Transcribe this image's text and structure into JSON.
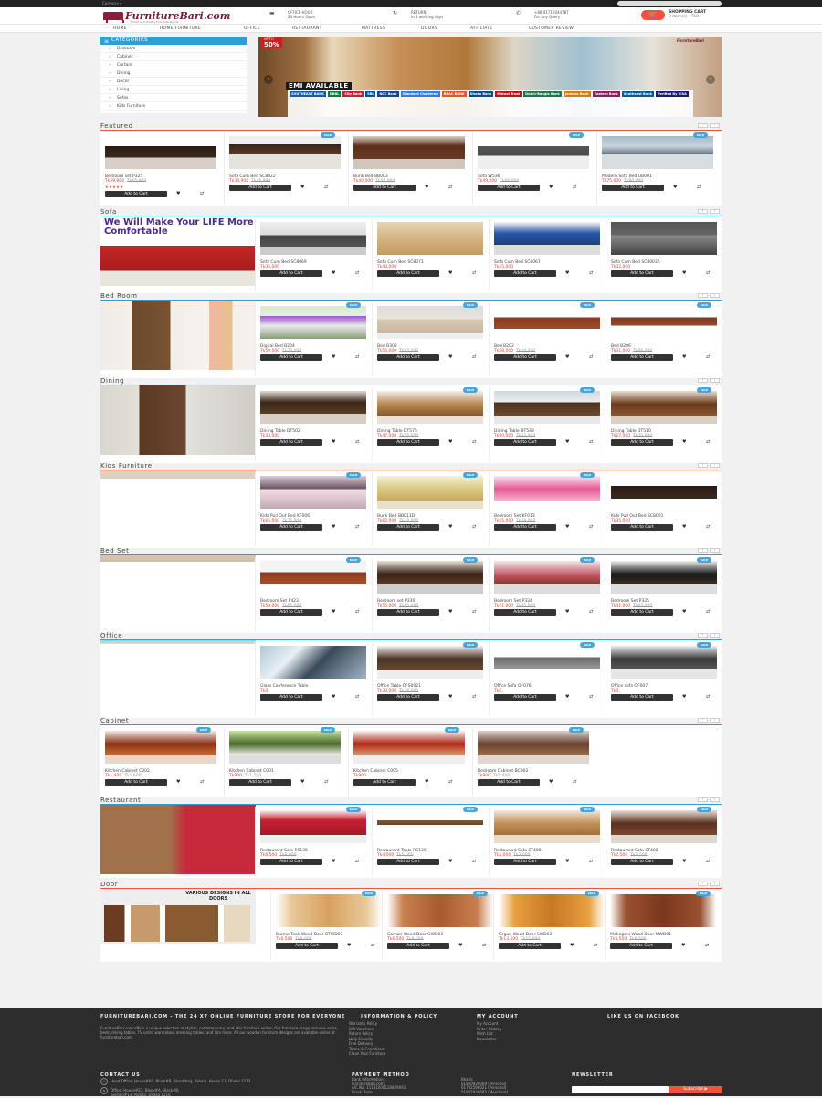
{
  "topbar": {
    "currency": "Currency ▾",
    "search_placeholder": "Search"
  },
  "header": {
    "logo": "FurnitureBari.com",
    "logo_sub": "Smart and Quality Furniture Online",
    "office_hour_title": "OFFICE HOUR",
    "office_hour_text": "24 Hours Open",
    "return_title": "RETURN",
    "return_text": "In 3 working days",
    "phone": "+88 01716044787",
    "phone_text": "For any Query",
    "cart_title": "SHOPPING CART",
    "cart_count": "0 item(s) - Tk0"
  },
  "nav": [
    "HOME",
    "HOME FURNITURE",
    "OFFICE",
    "RESTAURANT",
    "MATTRESS",
    "DOORS",
    "AFFILIATE",
    "CUSTOMER REVIEW"
  ],
  "categories": {
    "title": "CATEGORIES",
    "items": [
      "Bedroom",
      "Cabinet",
      "Curtain",
      "Dining",
      "Decor",
      "Living",
      "Sofas",
      "Kids Furniture"
    ]
  },
  "banner": {
    "sale_title": "UP TO",
    "sale_value": "50%",
    "emi": "EMI AVAILABLE",
    "banks": [
      "SOUTHEAST BANK",
      "DBBL",
      "City Bank",
      "EBL",
      "NCC Bank",
      "Standard Chartered",
      "BRAC BANK",
      "Dhaka Bank",
      "Mutual Trust",
      "Dutch-Bangla Bank",
      "Jamuna Bank",
      "Eastern Bank",
      "Southeast Bank",
      "Verified By VISA"
    ],
    "brand": "FurnitureBari"
  },
  "colors": {
    "accent": "#2c9fd4",
    "price": "#e4422d",
    "cart": "#f0523d",
    "footer": "#2d2d2d"
  },
  "sections": [
    {
      "title": "Featured",
      "products": [
        {
          "name": "Bedroom set P325",
          "price": "Tk59,900",
          "old": "Tk65,900",
          "sale": false,
          "stars": "★★★★★"
        },
        {
          "name": "Sofa Cum Bed SC8022",
          "price": "Tk39,900",
          "old": "Tk46,999",
          "sale": true
        },
        {
          "name": "Bunk Bed BB003",
          "price": "Tk40,000",
          "old": "Tk56,000",
          "sale": false
        },
        {
          "name": "Sofa W536",
          "price": "Tk49,000",
          "old": "Tk66,000",
          "sale": true
        },
        {
          "name": "Modern Sofa Bed UB001",
          "price": "Tk75,000",
          "old": "Tk90,000",
          "sale": true
        }
      ]
    },
    {
      "title": "Sofa",
      "promo": "We Will Make Your LIFE More Comfortable",
      "products": [
        {
          "name": "Sofa Cum Bed SC8069",
          "price": "Tk35,000",
          "old": "",
          "sale": false
        },
        {
          "name": "Sofa Cum Bed SC8071",
          "price": "Tk43,000",
          "old": "",
          "sale": false
        },
        {
          "name": "Sofa Cum Bed SC8067",
          "price": "Tk45,000",
          "old": "",
          "sale": false
        },
        {
          "name": "Sofa Cum Bed SC80035",
          "price": "Tk32,000",
          "old": "",
          "sale": false
        }
      ]
    },
    {
      "title": "Bed Room",
      "products": [
        {
          "name": "Digital Bed B204",
          "price": "Tk59,000",
          "old": "Tk70,000",
          "sale": true
        },
        {
          "name": "Bed B302",
          "price": "Tk55,000",
          "old": "Tk65,000",
          "sale": true
        },
        {
          "name": "Bed B202",
          "price": "Tk18,000",
          "old": "Tk24,000",
          "sale": true
        },
        {
          "name": "Bed B206",
          "price": "Tk31,000",
          "old": "Tk36,000",
          "sale": true
        }
      ]
    },
    {
      "title": "Dining",
      "products": [
        {
          "name": "Dining Table DT502",
          "price": "Tk33,000",
          "old": "",
          "sale": false
        },
        {
          "name": "Dining Table DT575",
          "price": "Tk47,000",
          "old": "Tk50,000",
          "sale": true
        },
        {
          "name": "Dining Table DT548",
          "price": "Tk60,000",
          "old": "Tk62,000",
          "sale": true
        },
        {
          "name": "Dining Table DT510",
          "price": "Tk27,000",
          "old": "Tk30,000",
          "sale": true
        }
      ]
    },
    {
      "title": "Kids Furniture",
      "products": [
        {
          "name": "Kids Pull Out Bed KF006",
          "price": "Tk65,000",
          "old": "Tk75,000",
          "sale": true
        },
        {
          "name": "Bunk Bed BB011D",
          "price": "Tk60,000",
          "old": "Tk70,000",
          "sale": true
        },
        {
          "name": "Bedroom Set KF013",
          "price": "Tk45,000",
          "old": "Tk49,000",
          "sale": true
        },
        {
          "name": "Kids Pull Out Bed SC8001",
          "price": "Tk35,000",
          "old": "",
          "sale": false
        }
      ]
    },
    {
      "title": "Bed Set",
      "products": [
        {
          "name": "Bedroom Set P423",
          "price": "Tk58,000",
          "old": "Tk65,000",
          "sale": true
        },
        {
          "name": "Bedroom set P330",
          "price": "Tk55,000",
          "old": "Tk60,000",
          "sale": true
        },
        {
          "name": "Bedroom Set P334",
          "price": "Tk41,000",
          "old": "Tk45,000",
          "sale": true
        },
        {
          "name": "Bedroom Set P335",
          "price": "Tk41,000",
          "old": "Tk45,000",
          "sale": true
        }
      ]
    },
    {
      "title": "Office",
      "products": [
        {
          "name": "Glass Conference Table",
          "price": "Tk0",
          "old": "",
          "sale": false
        },
        {
          "name": "Office Table OFS0021",
          "price": "Tk30,000",
          "old": "Tk36,000",
          "sale": true
        },
        {
          "name": "Office Sofa OF076",
          "price": "Tk0",
          "old": "",
          "sale": true
        },
        {
          "name": "Office sofa OF007",
          "price": "Tk0",
          "old": "",
          "sale": true
        }
      ]
    },
    {
      "title": "Cabinet",
      "products": [
        {
          "name": "Kitchen Cabinet C002",
          "price": "Tk1,400",
          "old": "Tk1,600",
          "sale": true
        },
        {
          "name": "Kitchen Cabinet C001",
          "price": "Tk900",
          "old": "Tk1,100",
          "sale": true
        },
        {
          "name": "Kitchen Cabinet C005",
          "price": "Tk900",
          "old": "",
          "sale": true
        },
        {
          "name": "Bedroom Cabinet BC002",
          "price": "Tk900",
          "old": "Tk1,400",
          "sale": true
        }
      ]
    },
    {
      "title": "Restaurant",
      "products": [
        {
          "name": "Restaurant Sofa RS135",
          "price": "Tk6,500",
          "old": "Tk8,000",
          "sale": true
        },
        {
          "name": "Restaurant Table RS136",
          "price": "Tk4,000",
          "old": "Tk5,000",
          "sale": true
        },
        {
          "name": "Restaurant Sofa ST406",
          "price": "Tk2,000",
          "old": "Tk3,000",
          "sale": true
        },
        {
          "name": "Restaurant Sofa ST402",
          "price": "Tk2,500",
          "old": "Tk3,500",
          "sale": true
        }
      ]
    },
    {
      "title": "Door",
      "promo": "VARIOUS DESIGNS IN ALL DOORS",
      "products": [
        {
          "name": "Burma Teak Wood Door BTWD03",
          "price": "Tk6,500",
          "old": "Tk8,000",
          "sale": true
        },
        {
          "name": "Gamari Wood Door GWD03",
          "price": "Tk6,500",
          "old": "Tk8,000",
          "sale": true
        },
        {
          "name": "Segun Wood Door SWD03",
          "price": "Tk13,500",
          "old": "Tk15,000",
          "sale": true
        },
        {
          "name": "Mehogoni Wood Door MWD01",
          "price": "Tk5,500",
          "old": "Tk6,500",
          "sale": true
        }
      ]
    }
  ],
  "ui": {
    "add_to_cart": "Add to Cart"
  },
  "footer": {
    "about_title": "FURNITUREBARI.COM - THE 24 X7 ONLINE FURNITURE STORE FOR EVERYONE",
    "about_text": "FurnitureBari.com offers a unique selection of stylish, contemporary, and chic furniture online. Our furniture range includes sofas, beds, dining tables, TV units, wardrobes, dressing tables, and lots more. All our wooden furniture designs are available online at furniturebari.com.",
    "info_title": "INFORMATION & POLICY",
    "info_links": [
      "Warranty Policy",
      "Gift Vouchers",
      "Return Policy",
      "Help Friendly",
      "Free Delivery",
      "Terms & Conditions",
      "Clean Your Furniture"
    ],
    "account_title": "MY ACCOUNT",
    "account_links": [
      "My Account",
      "Order History",
      "Wish List",
      "Newsletter"
    ],
    "facebook_title": "LIKE US ON FACEBOOK",
    "contact_title": "CONTACT US",
    "contact_lines": [
      "Head Office: House#60, Block#B, Shantibag, Pahela, House 13, Dhaka 1212",
      "Office: House#27, Block#A, Block#B,",
      "Section#13, Pallabi, Dhaka 1216"
    ],
    "payment_title": "PAYMENT METHOD",
    "payment_lines": [
      "Bank Information:",
      "FurnitureBari.com",
      "A/C No. 11131000120809091",
      "Brack Bank"
    ],
    "bkash_lines": [
      "Bkash:",
      "01850926069 (Personal)",
      "01792598021 (Personal)",
      "01865936685 (Merchant)"
    ],
    "newsletter_title": "NEWSLETTER",
    "newsletter_button": "Subscribe ▶"
  }
}
